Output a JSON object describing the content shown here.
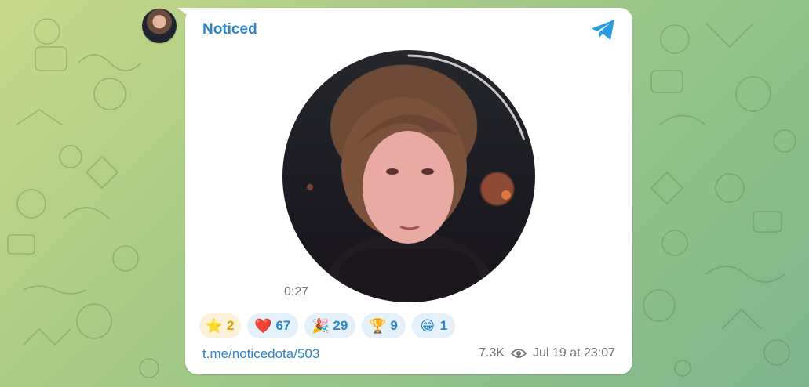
{
  "channel": {
    "author": "Noticed"
  },
  "video": {
    "duration": "0:27",
    "progress": 0.2
  },
  "reactions": [
    {
      "emoji": "⭐",
      "icon": "star-icon",
      "count": "2",
      "paid": true
    },
    {
      "emoji": "❤️",
      "icon": "heart-icon",
      "count": "67"
    },
    {
      "emoji": "🎉",
      "icon": "party-popper-icon",
      "count": "29"
    },
    {
      "emoji": "🏆",
      "icon": "trophy-icon",
      "count": "9"
    },
    {
      "emoji": "😁",
      "icon": "grinning-face-icon",
      "count": "1"
    }
  ],
  "footer": {
    "link": "t.me/noticedota/503",
    "views": "7.3K",
    "time": "Jul 19 at 23:07"
  },
  "colors": {
    "accent": "#2a86c9",
    "meta": "#707579",
    "paid_bg": "#fdf1d8",
    "reaction_bg": "#e5f1fa"
  }
}
